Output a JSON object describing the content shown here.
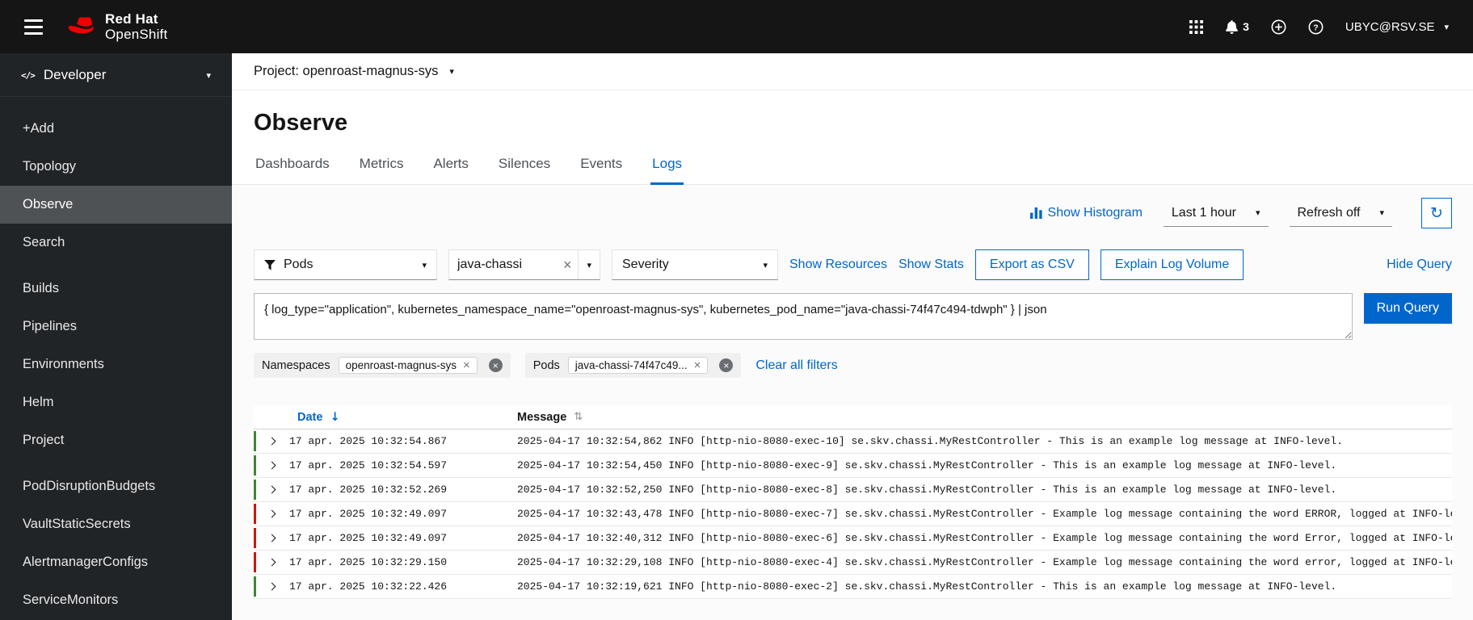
{
  "colors": {
    "accent": "#0066cc",
    "brand_red": "#ee0000",
    "severity_info": "#3e8635",
    "severity_error": "#c9190b",
    "masthead_bg": "#151515",
    "sidebar_bg": "#212427"
  },
  "icons": {
    "caret_down": "▾",
    "close": "×",
    "refresh": "↻",
    "sort_desc": "↓",
    "sort_both": "⇅"
  },
  "header": {
    "brand": {
      "line1": "Red Hat",
      "line2": "OpenShift"
    },
    "notifications_count": "3",
    "user": "UBYC@RSV.SE"
  },
  "sidebar": {
    "perspective": "Developer",
    "items": [
      {
        "label": "+Add"
      },
      {
        "label": "Topology"
      },
      {
        "label": "Observe",
        "active": true
      },
      {
        "label": "Search"
      },
      {
        "label": "Builds"
      },
      {
        "label": "Pipelines"
      },
      {
        "label": "Environments"
      },
      {
        "label": "Helm"
      },
      {
        "label": "Project"
      },
      {
        "label": "PodDisruptionBudgets"
      },
      {
        "label": "VaultStaticSecrets"
      },
      {
        "label": "AlertmanagerConfigs"
      },
      {
        "label": "ServiceMonitors"
      }
    ]
  },
  "project_bar": {
    "label": "Project: openroast-magnus-sys"
  },
  "page": {
    "title": "Observe"
  },
  "tabs": [
    {
      "label": "Dashboards"
    },
    {
      "label": "Metrics"
    },
    {
      "label": "Alerts"
    },
    {
      "label": "Silences"
    },
    {
      "label": "Events"
    },
    {
      "label": "Logs",
      "active": true
    }
  ],
  "toolbar": {
    "show_histogram": "Show Histogram",
    "time_range": "Last 1 hour",
    "refresh": "Refresh off"
  },
  "filters": {
    "attribute_dropdown": "Pods",
    "search_value": "java-chassi",
    "severity_dropdown": "Severity",
    "show_resources": "Show Resources",
    "show_stats": "Show Stats",
    "export_csv": "Export as CSV",
    "explain_log_volume": "Explain Log Volume",
    "hide_query": "Hide Query",
    "query": "{ log_type=\"application\", kubernetes_namespace_name=\"openroast-magnus-sys\", kubernetes_pod_name=\"java-chassi-74f47c494-tdwph\" } | json",
    "run_query": "Run Query",
    "chip_groups": [
      {
        "label": "Namespaces",
        "chips": [
          "openroast-magnus-sys"
        ]
      },
      {
        "label": "Pods",
        "chips": [
          "java-chassi-74f47c49..."
        ]
      }
    ],
    "clear_all": "Clear all filters"
  },
  "table": {
    "columns": [
      "Date",
      "Message"
    ],
    "rows": [
      {
        "severity": "info",
        "date": "17 apr. 2025 10:32:54.867",
        "message": "2025-04-17 10:32:54,862 INFO [http-nio-8080-exec-10] se.skv.chassi.MyRestController - This is an example log message at INFO-level."
      },
      {
        "severity": "info",
        "date": "17 apr. 2025 10:32:54.597",
        "message": "2025-04-17 10:32:54,450 INFO [http-nio-8080-exec-9] se.skv.chassi.MyRestController - This is an example log message at INFO-level."
      },
      {
        "severity": "info",
        "date": "17 apr. 2025 10:32:52.269",
        "message": "2025-04-17 10:32:52,250 INFO [http-nio-8080-exec-8] se.skv.chassi.MyRestController - This is an example log message at INFO-level."
      },
      {
        "severity": "error",
        "date": "17 apr. 2025 10:32:49.097",
        "message": "2025-04-17 10:32:43,478 INFO [http-nio-8080-exec-7] se.skv.chassi.MyRestController - Example log message containing the word ERROR, logged at INFO-level."
      },
      {
        "severity": "error",
        "date": "17 apr. 2025 10:32:49.097",
        "message": "2025-04-17 10:32:40,312 INFO [http-nio-8080-exec-6] se.skv.chassi.MyRestController - Example log message containing the word Error, logged at INFO-level."
      },
      {
        "severity": "error",
        "date": "17 apr. 2025 10:32:29.150",
        "message": "2025-04-17 10:32:29,108 INFO [http-nio-8080-exec-4] se.skv.chassi.MyRestController - Example log message containing the word error, logged at INFO-level."
      },
      {
        "severity": "info",
        "date": "17 apr. 2025 10:32:22.426",
        "message": "2025-04-17 10:32:19,621 INFO [http-nio-8080-exec-2] se.skv.chassi.MyRestController - This is an example log message at INFO-level."
      }
    ]
  }
}
